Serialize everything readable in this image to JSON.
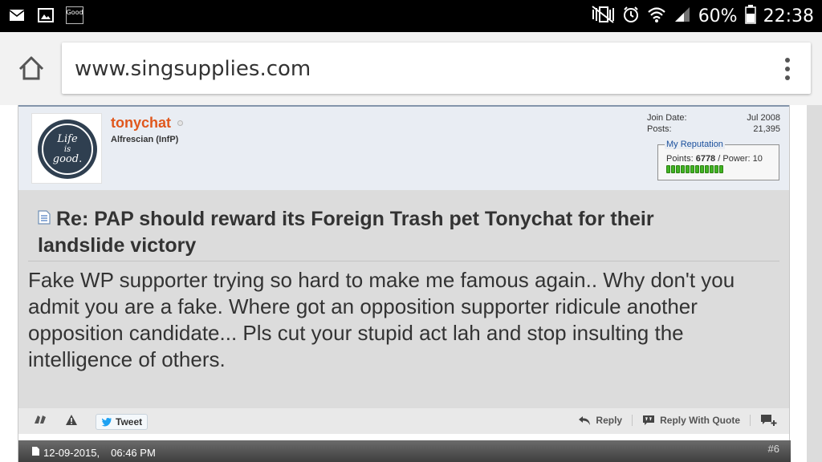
{
  "statusbar": {
    "notif_badge": "Good",
    "battery": "60%",
    "time": "22:38"
  },
  "browser": {
    "url": "www.singsupplies.com"
  },
  "post": {
    "username": "tonychat",
    "user_title": "Alfrescian (InfP)",
    "avatar_text": [
      "Life",
      "is",
      "good."
    ],
    "join_date_label": "Join Date:",
    "join_date": "Jul 2008",
    "posts_label": "Posts:",
    "posts": "21,395",
    "reputation_legend": "My Reputation",
    "points_label": "Points:",
    "points": "6778",
    "power_label": "/ Power:",
    "power": "10",
    "title": "Re: PAP should reward its Foreign Trash pet Tonychat for their landslide victory",
    "body": "Fake WP supporter trying so hard to make me famous again.. Why don't you admit you are a fake. Where got an opposition supporter ridicule another opposition candidate... Pls cut your stupid act lah and stop insulting the intelligence of others."
  },
  "footer": {
    "tweet": "Tweet",
    "reply": "Reply",
    "reply_quote": "Reply With Quote"
  },
  "next_post": {
    "date": "12-09-2015,",
    "time": "06:46 PM",
    "number": "#6"
  },
  "colors": {
    "username": "#e0571c",
    "reputation_bar": "#41b423",
    "header_border": "#8495ab"
  }
}
